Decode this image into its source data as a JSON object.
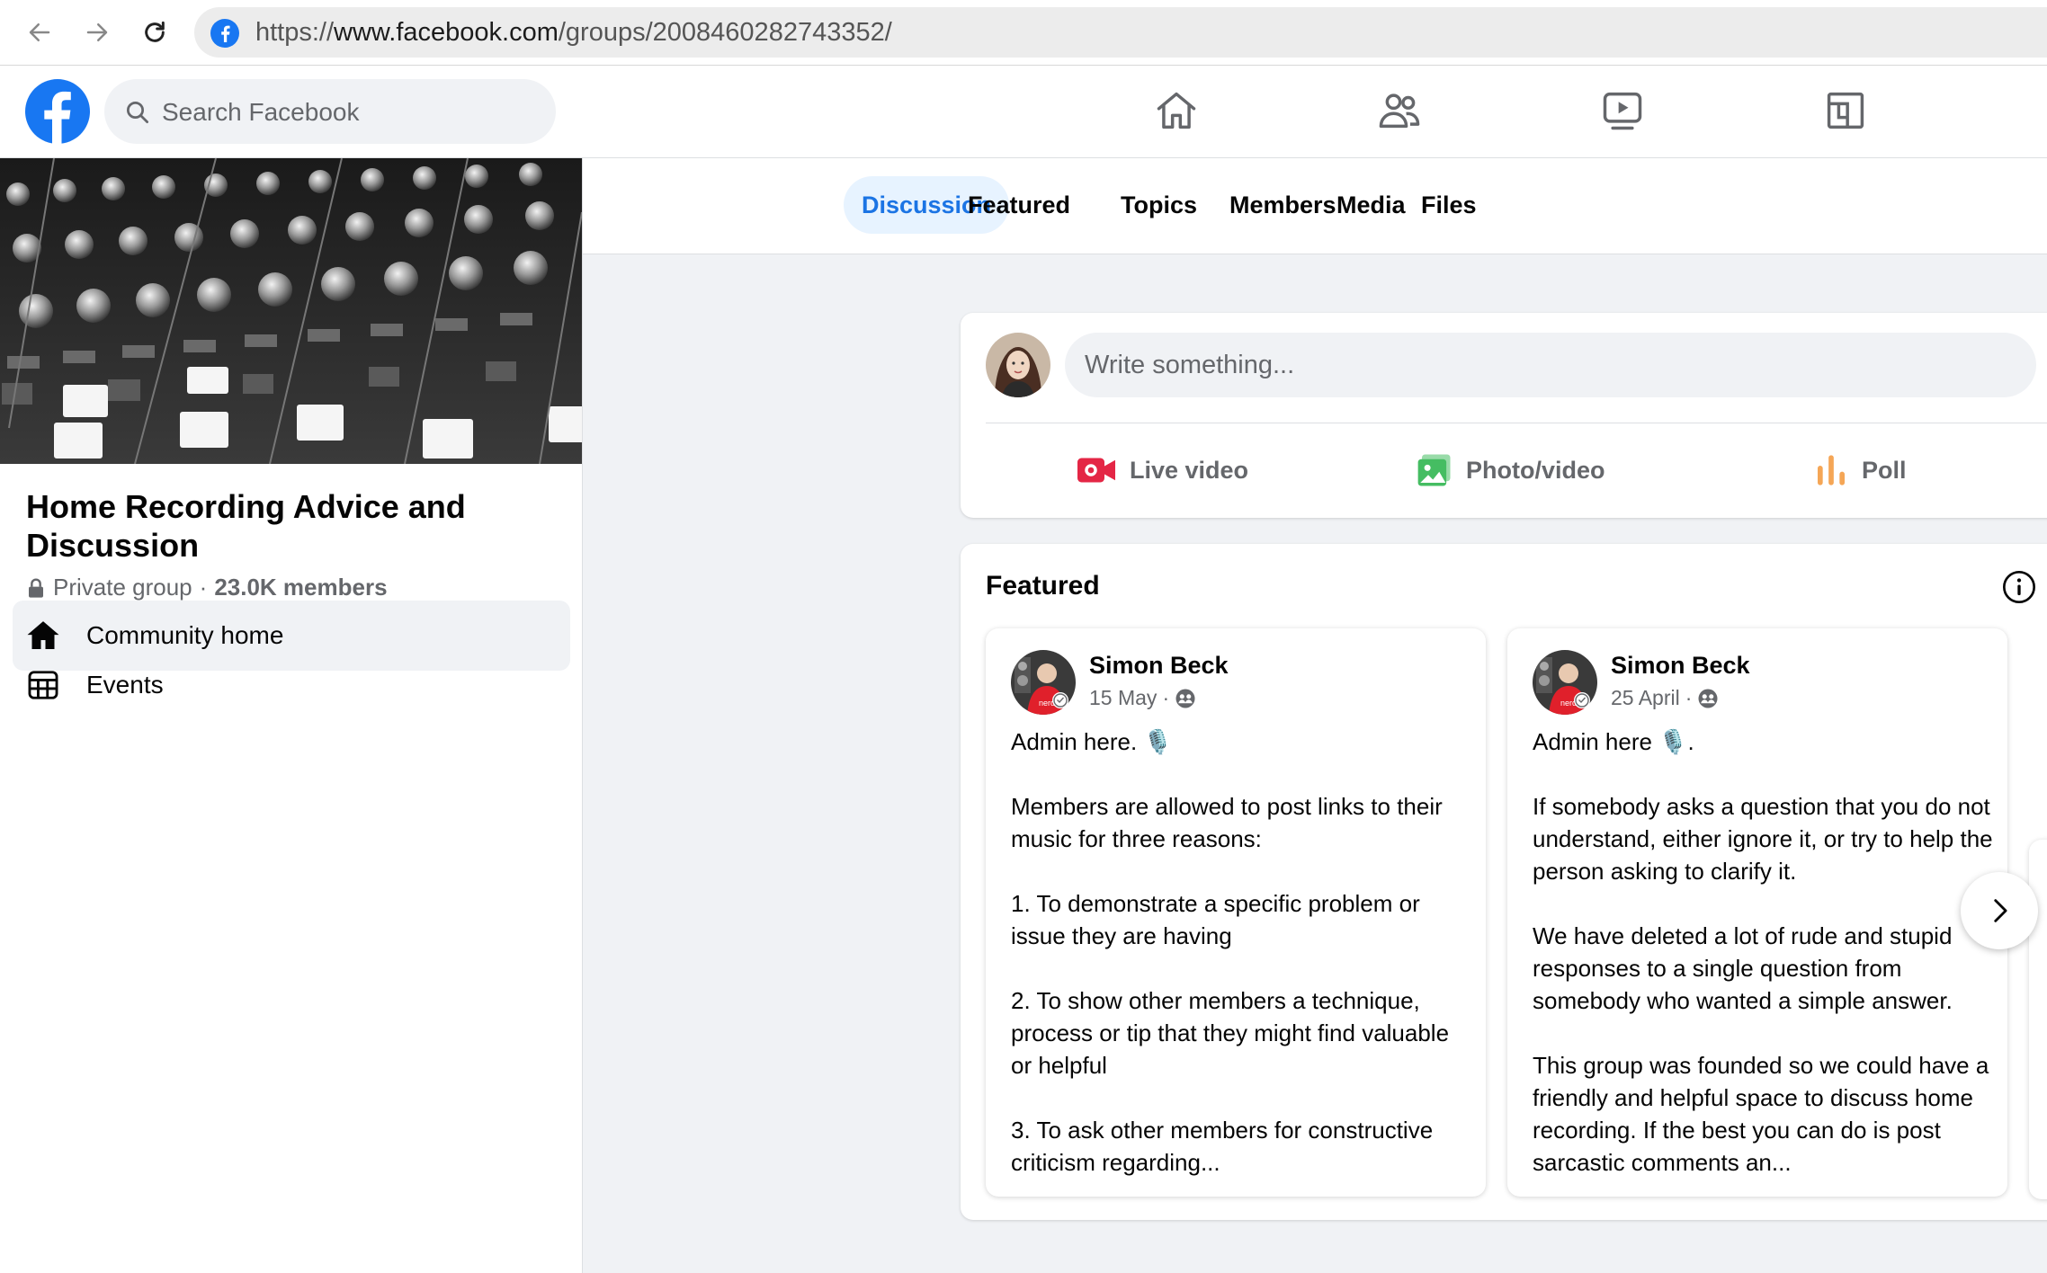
{
  "browser": {
    "url_prefix": "https://",
    "url_host": "www.facebook.com",
    "url_path": "/groups/2008460282743352/"
  },
  "topnav": {
    "search_placeholder": "Search Facebook",
    "icons": [
      "home-icon",
      "friends-icon",
      "watch-icon",
      "gaming-icon"
    ],
    "brand_color": "#1877f2"
  },
  "group": {
    "name": "Home Recording Advice and Discussion",
    "privacy": "Private group",
    "separator": "·",
    "members": "23.0K members"
  },
  "sidebar": {
    "items": [
      {
        "label": "Community home",
        "icon": "home-icon",
        "active": true
      },
      {
        "label": "Events",
        "icon": "calendar-icon",
        "active": false
      }
    ]
  },
  "tabs": [
    {
      "label": "Discussion",
      "active": true
    },
    {
      "label": "Featured",
      "active": false
    },
    {
      "label": "Topics",
      "active": false
    },
    {
      "label": "Members",
      "active": false
    },
    {
      "label": "Media",
      "active": false
    },
    {
      "label": "Files",
      "active": false
    }
  ],
  "composer": {
    "placeholder": "Write something...",
    "actions": [
      {
        "label": "Live video",
        "icon": "live-video-icon",
        "color": "#e42645"
      },
      {
        "label": "Photo/video",
        "icon": "photo-icon",
        "color": "#45bd62"
      },
      {
        "label": "Poll",
        "icon": "poll-icon",
        "color": "#f7b928"
      }
    ]
  },
  "featured": {
    "title": "Featured",
    "posts": [
      {
        "author": "Simon Beck",
        "date": "15 May",
        "dot": "·",
        "paragraphs": [
          "Admin here. 🎙️",
          "Members are allowed to post links to their music for three reasons:",
          "1. To demonstrate a specific problem or issue they are having",
          "2. To show other members a technique, process or tip that they might find valuable or helpful",
          "3. To ask other members for constructive criticism regarding..."
        ]
      },
      {
        "author": "Simon Beck",
        "date": "25 April",
        "dot": "·",
        "paragraphs": [
          "Admin here 🎙️.",
          "If somebody asks a question that you do not understand, either ignore it, or try to help the person asking to clarify it.",
          "We have deleted a lot of rude and stupid responses to a single question from somebody who wanted a simple answer.",
          "This group was founded so we could have a friendly and helpful space to discuss home recording. If the best you can do is post sarcastic comments an..."
        ]
      }
    ]
  }
}
